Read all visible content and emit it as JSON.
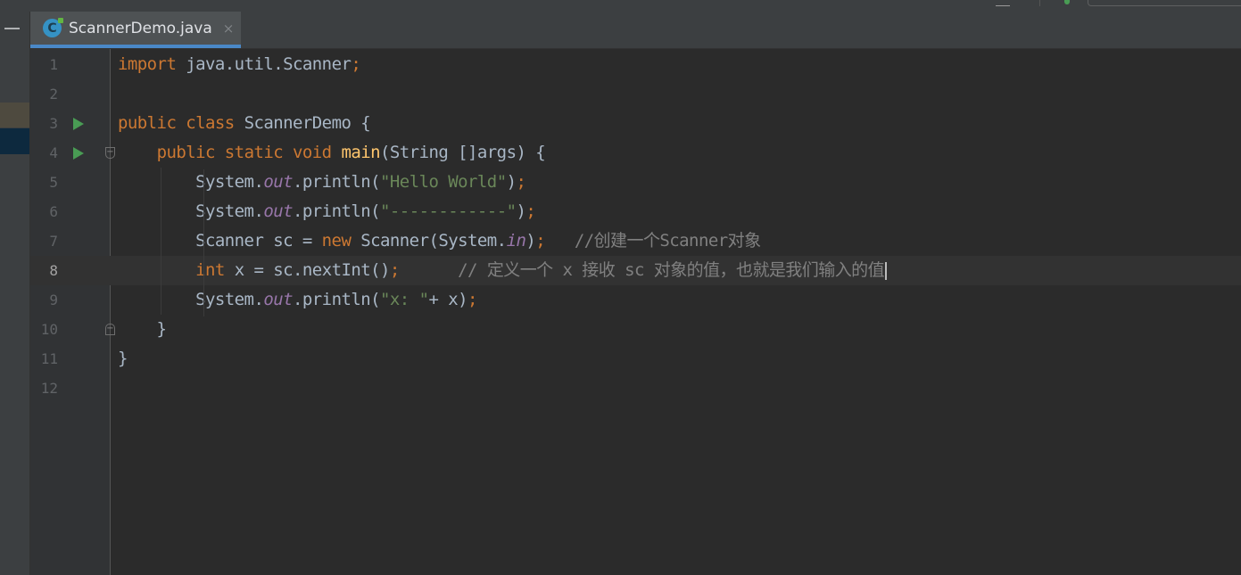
{
  "tabs": [
    {
      "label": "ScannerDemo.java",
      "close": "×",
      "icon_letter": "C",
      "active": true
    }
  ],
  "editor": {
    "current_line": 8,
    "lines": [
      {
        "n": "1",
        "segments": [
          [
            "kw",
            "import "
          ],
          [
            "",
            "java.util.Scanner"
          ],
          [
            "kw",
            ";"
          ]
        ]
      },
      {
        "n": "2",
        "segments": []
      },
      {
        "n": "3",
        "run": true,
        "segments": [
          [
            "kw",
            "public class "
          ],
          [
            "",
            "ScannerDemo {"
          ]
        ]
      },
      {
        "n": "4",
        "run": true,
        "fold": "open",
        "segments": [
          [
            "",
            "    "
          ],
          [
            "kw",
            "public static void "
          ],
          [
            "fn",
            "main"
          ],
          [
            "",
            "(String []args) {"
          ]
        ]
      },
      {
        "n": "5",
        "segments": [
          [
            "",
            "        System."
          ],
          [
            "field",
            "out"
          ],
          [
            "",
            ".println("
          ],
          [
            "str",
            "\"Hello World\""
          ],
          [
            "",
            ")"
          ],
          [
            "kw",
            ";"
          ]
        ]
      },
      {
        "n": "6",
        "segments": [
          [
            "",
            "        System."
          ],
          [
            "field",
            "out"
          ],
          [
            "",
            ".println("
          ],
          [
            "str",
            "\"------------\""
          ],
          [
            "",
            ")"
          ],
          [
            "kw",
            ";"
          ]
        ]
      },
      {
        "n": "7",
        "segments": [
          [
            "",
            "        Scanner sc = "
          ],
          [
            "kw",
            "new "
          ],
          [
            "",
            "Scanner(System."
          ],
          [
            "field",
            "in"
          ],
          [
            "",
            ")"
          ],
          [
            "kw",
            ";"
          ],
          [
            "",
            "   "
          ],
          [
            "cmt",
            "//创建一个Scanner对象"
          ]
        ]
      },
      {
        "n": "8",
        "segments": [
          [
            "",
            "        "
          ],
          [
            "kw",
            "int "
          ],
          [
            "",
            "x = sc.nextInt()"
          ],
          [
            "kw",
            ";"
          ],
          [
            "",
            "      "
          ],
          [
            "cmt",
            "// 定义一个 x 接收 sc 对象的值，也就是我们输入的值"
          ]
        ]
      },
      {
        "n": "9",
        "segments": [
          [
            "",
            "        System."
          ],
          [
            "field",
            "out"
          ],
          [
            "",
            ".println("
          ],
          [
            "str",
            "\"x: \""
          ],
          [
            "",
            "+ x)"
          ],
          [
            "kw",
            ";"
          ]
        ]
      },
      {
        "n": "10",
        "fold": "close",
        "segments": [
          [
            "",
            "    }"
          ]
        ]
      },
      {
        "n": "11",
        "segments": [
          [
            "",
            "}"
          ]
        ]
      },
      {
        "n": "12",
        "segments": []
      }
    ]
  },
  "colors": {
    "background": "#2b2b2b",
    "keyword": "#cc7832",
    "function": "#ffc66d",
    "string": "#6a8759",
    "field": "#9876aa",
    "comment": "#808080",
    "plain": "#a9b7c6",
    "run": "#499c54",
    "tab_underline": "#4a88c7"
  }
}
